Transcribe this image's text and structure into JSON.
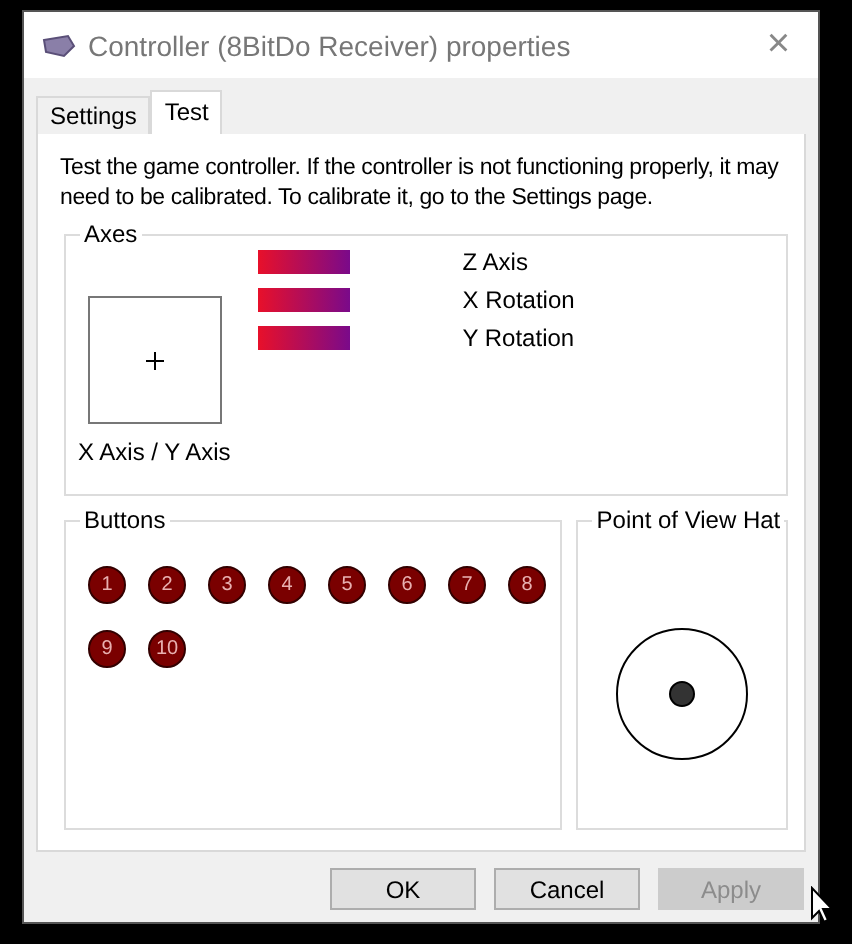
{
  "window": {
    "title": "Controller (8BitDo Receiver) properties",
    "close": "×"
  },
  "tabs": [
    {
      "label": "Settings",
      "selected": false
    },
    {
      "label": "Test",
      "selected": true
    }
  ],
  "description": "Test the game controller.  If the controller is not functioning properly, it may need to be calibrated.  To calibrate it, go to the Settings page.",
  "axes": {
    "title": "Axes",
    "xy_label": "X Axis / Y Axis",
    "bars": [
      {
        "label": "Z Axis"
      },
      {
        "label": "X Rotation"
      },
      {
        "label": "Y Rotation"
      }
    ]
  },
  "buttons_group": {
    "title": "Buttons",
    "buttons": [
      {
        "label": "1",
        "pressed": false
      },
      {
        "label": "2",
        "pressed": false
      },
      {
        "label": "3",
        "pressed": false
      },
      {
        "label": "4",
        "pressed": false
      },
      {
        "label": "5",
        "pressed": false
      },
      {
        "label": "6",
        "pressed": false
      },
      {
        "label": "7",
        "pressed": false
      },
      {
        "label": "8",
        "pressed": false
      },
      {
        "label": "9",
        "pressed": false
      },
      {
        "label": "10",
        "pressed": false
      }
    ]
  },
  "pov": {
    "title": "Point of View Hat"
  },
  "footer_buttons": [
    {
      "label": "OK",
      "disabled": false
    },
    {
      "label": "Cancel",
      "disabled": false
    },
    {
      "label": "Apply",
      "disabled": true
    }
  ]
}
